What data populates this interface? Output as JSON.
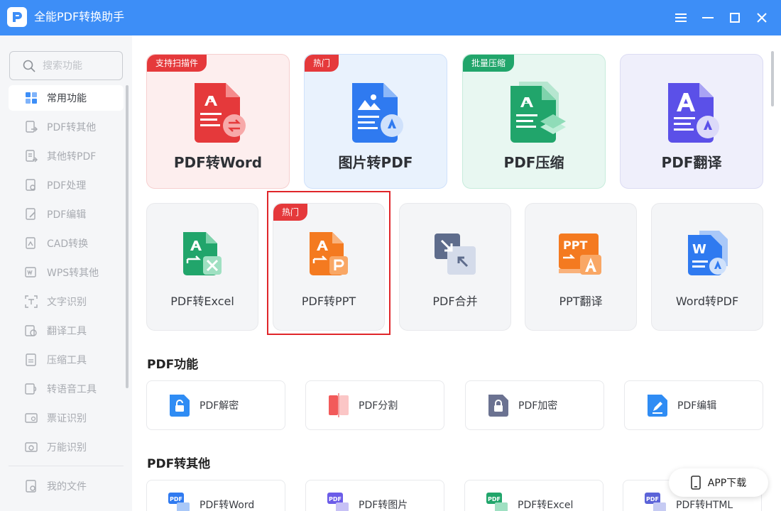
{
  "app": {
    "title": "全能PDF转换助手"
  },
  "search": {
    "placeholder": "搜索功能"
  },
  "sidebar": {
    "items": [
      {
        "label": "常用功能",
        "icon": "common-features-icon",
        "active": true
      },
      {
        "label": "PDF转其他",
        "icon": "pdf-to-other-icon"
      },
      {
        "label": "其他转PDF",
        "icon": "other-to-pdf-icon"
      },
      {
        "label": "PDF处理",
        "icon": "pdf-process-icon"
      },
      {
        "label": "PDF编辑",
        "icon": "pdf-edit-icon"
      },
      {
        "label": "CAD转换",
        "icon": "cad-convert-icon"
      },
      {
        "label": "WPS转其他",
        "icon": "wps-convert-icon"
      },
      {
        "label": "文字识别",
        "icon": "ocr-icon"
      },
      {
        "label": "翻译工具",
        "icon": "translate-icon"
      },
      {
        "label": "压缩工具",
        "icon": "compress-icon"
      },
      {
        "label": "转语音工具",
        "icon": "text-to-speech-icon"
      },
      {
        "label": "票证识别",
        "icon": "ticket-ocr-icon"
      },
      {
        "label": "万能识别",
        "icon": "universal-ocr-icon"
      }
    ],
    "my_files": "我的文件"
  },
  "featured": [
    {
      "label": "PDF转Word",
      "tag": "支持扫描件",
      "tag_color": "#e5393b",
      "bg": "#fdeeee",
      "accent": "#e5393b"
    },
    {
      "label": "图片转PDF",
      "tag": "热门",
      "tag_color": "#e5393b",
      "bg": "#e9f2fd",
      "accent": "#2f7af0"
    },
    {
      "label": "PDF压缩",
      "tag": "批量压缩",
      "tag_color": "#21a56b",
      "bg": "#e8f7f1",
      "accent": "#21a56b"
    },
    {
      "label": "PDF翻译",
      "tag": "",
      "tag_color": "",
      "bg": "#efeffb",
      "accent": "#5b50e8"
    }
  ],
  "tools": [
    {
      "label": "PDF转Excel",
      "tag": ""
    },
    {
      "label": "PDF转PPT",
      "tag": "热门"
    },
    {
      "label": "PDF合并",
      "tag": ""
    },
    {
      "label": "PPT翻译",
      "tag": ""
    },
    {
      "label": "Word转PDF",
      "tag": ""
    }
  ],
  "sections": {
    "pdf_functions": {
      "title": "PDF功能",
      "items": [
        "PDF解密",
        "PDF分割",
        "PDF加密",
        "PDF编辑"
      ]
    },
    "pdf_to_other": {
      "title": "PDF转其他",
      "items": [
        "PDF转Word",
        "PDF转图片",
        "PDF转Excel",
        "PDF转HTML"
      ]
    }
  },
  "app_download": "APP下载",
  "colors": {
    "titlebar": "#3d8ef7",
    "highlight": "#e0262a"
  }
}
